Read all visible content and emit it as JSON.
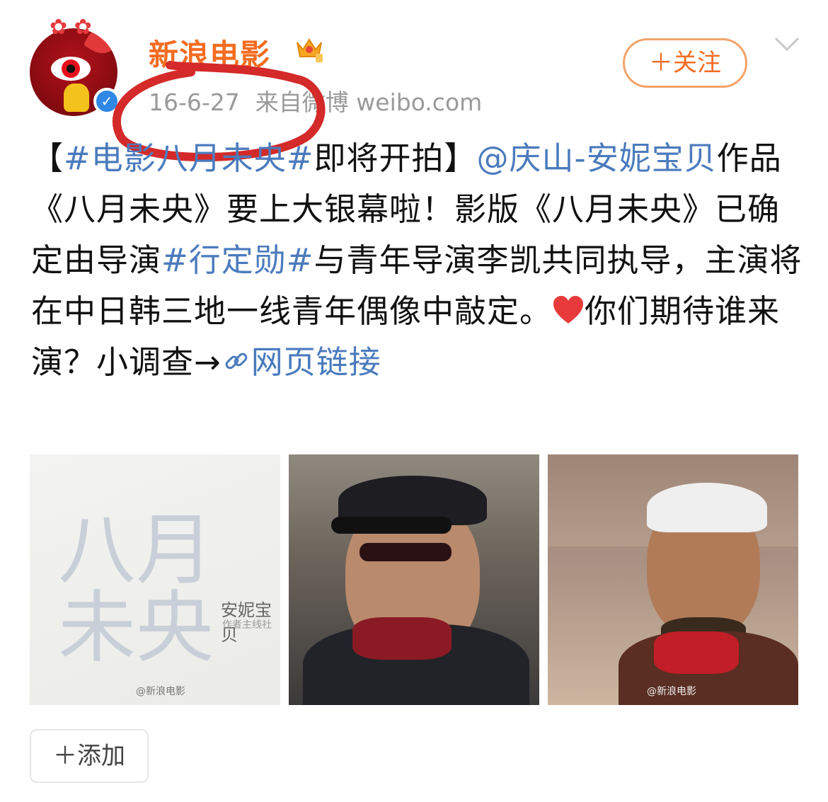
{
  "header": {
    "username": "新浪电影",
    "date": "16-6-27",
    "source": "来自微博 weibo.com",
    "follow_label": "＋关注"
  },
  "post": {
    "segments": [
      {
        "text": "【",
        "type": "text"
      },
      {
        "text": "#电影八月未央#",
        "type": "link"
      },
      {
        "text": "即将开拍】",
        "type": "text"
      },
      {
        "text": "@庆山-安妮宝贝",
        "type": "link"
      },
      {
        "text": "作品《八月未央》要上大银幕啦！影版《八月未央》已确定由导演",
        "type": "text"
      },
      {
        "text": "#行定勋#",
        "type": "link"
      },
      {
        "text": "与青年导演李凯共同执导，主演将在中日韩三地一线青年偶像中敲定。",
        "type": "text"
      },
      {
        "text": "你们期待谁来演？小调查→",
        "type": "text"
      },
      {
        "text": "网页链接",
        "type": "link"
      }
    ]
  },
  "photos": {
    "photo1_title": "八月未央",
    "photo1_author": "安妮宝贝",
    "photo1_sub": "作者主线社",
    "photo1_watermark": "@新浪电影",
    "photo3_watermark": "@新浪电影"
  },
  "actions": {
    "add_label": "＋添加"
  },
  "icons": {
    "verify": "verified-badge-icon",
    "crown": "crown-vip-icon",
    "heart": "heart-emoji-icon",
    "link": "link-icon",
    "chevron": "chevron-down-icon"
  },
  "colors": {
    "username": "#f36c21",
    "link": "#4b7bbd",
    "meta": "#9a9a9a",
    "annotation": "#d42a2a"
  }
}
